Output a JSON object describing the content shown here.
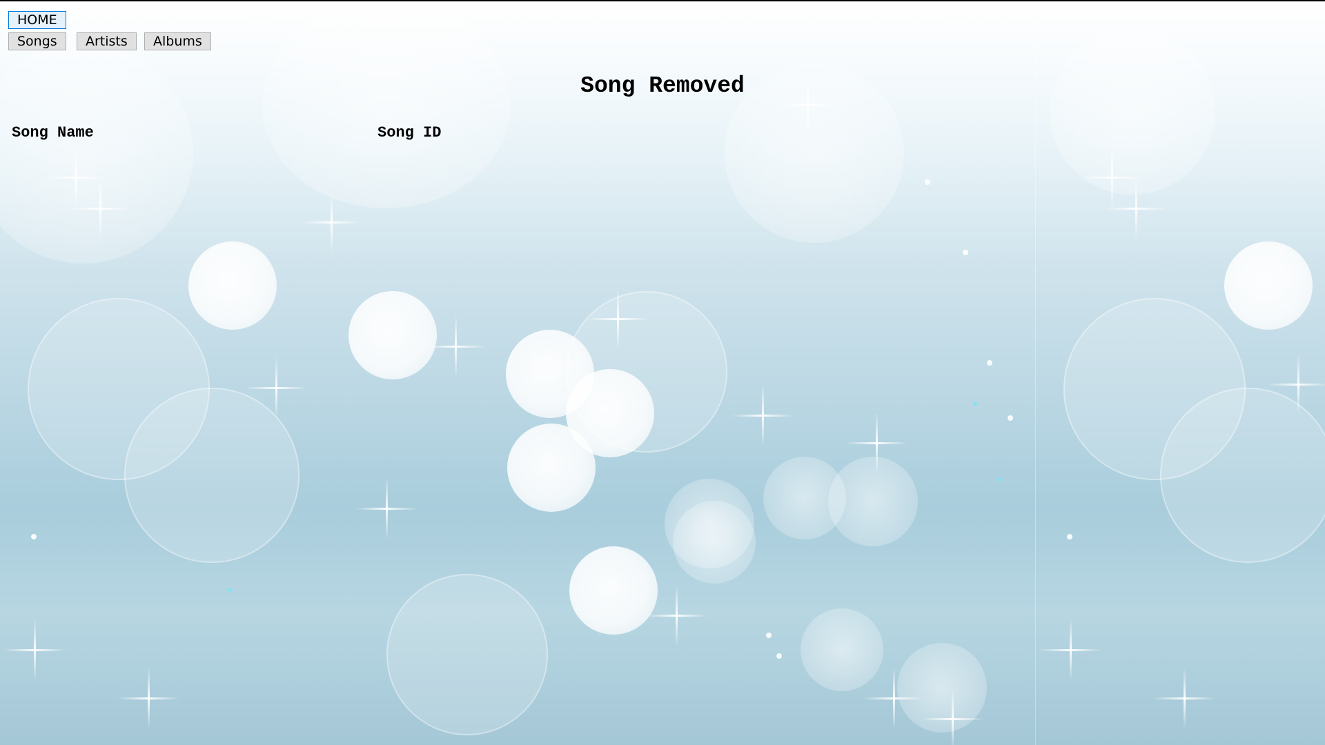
{
  "nav": {
    "home_label": "HOME",
    "songs_label": "Songs",
    "artists_label": "Artists",
    "albums_label": "Albums"
  },
  "main": {
    "title": "Song Removed",
    "table": {
      "columns": [
        "Song Name",
        "Song ID"
      ],
      "rows": []
    }
  },
  "colors": {
    "home_button_border": "#0078d7",
    "home_button_bg": "#e5f1fb",
    "button_bg": "#e1e1e1",
    "text": "#000000"
  }
}
